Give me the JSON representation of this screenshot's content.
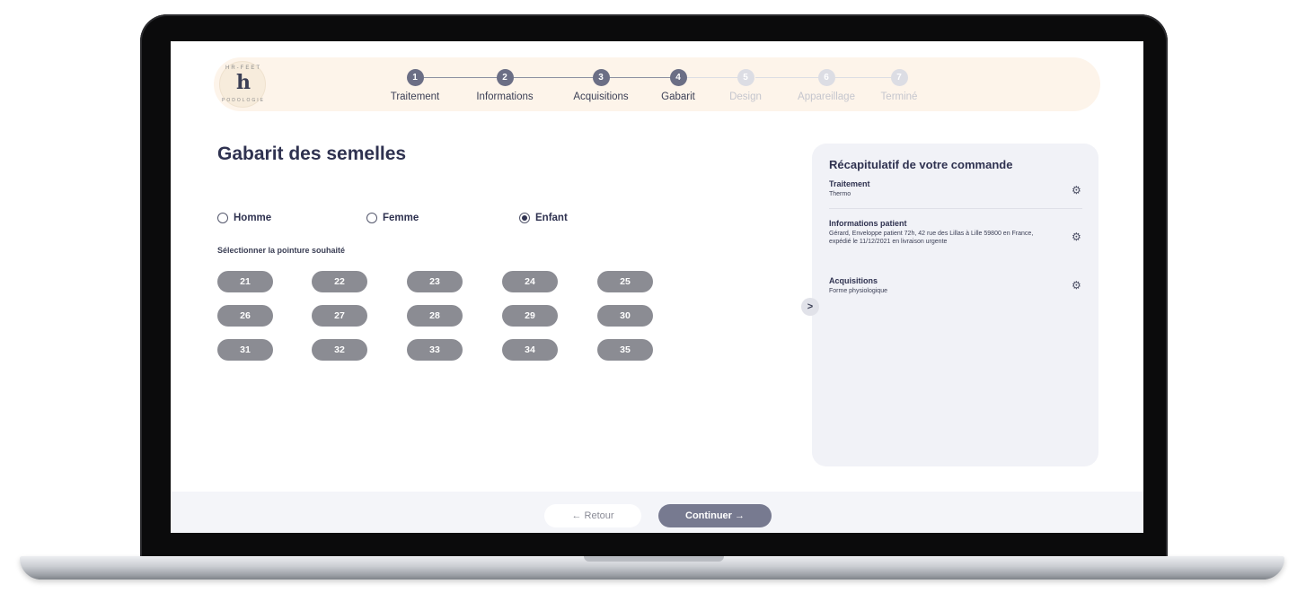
{
  "logo": {
    "letter": "h",
    "top_text": "HR-FEET",
    "bottom_text": "PODOLOGIE"
  },
  "stepper": {
    "steps": [
      {
        "num": "1",
        "label": "Traitement",
        "active": true
      },
      {
        "num": "2",
        "label": "Informations",
        "active": true
      },
      {
        "num": "3",
        "label": "Acquisitions",
        "active": true
      },
      {
        "num": "4",
        "label": "Gabarit",
        "active": true
      },
      {
        "num": "5",
        "label": "Design",
        "active": false
      },
      {
        "num": "6",
        "label": "Appareillage",
        "active": false
      },
      {
        "num": "7",
        "label": "Terminé",
        "active": false
      }
    ]
  },
  "main": {
    "title": "Gabarit des semelles",
    "genders": [
      {
        "label": "Homme",
        "checked": false
      },
      {
        "label": "Femme",
        "checked": false
      },
      {
        "label": "Enfant",
        "checked": true
      }
    ],
    "subtitle": "Sélectionner la pointure souhaité",
    "sizes": [
      "21",
      "22",
      "23",
      "24",
      "25",
      "26",
      "27",
      "28",
      "29",
      "30",
      "31",
      "32",
      "33",
      "34",
      "35"
    ]
  },
  "summary": {
    "title": "Récapitulatif de votre commande",
    "items": [
      {
        "label": "Traitement",
        "value": "Thermo"
      },
      {
        "label": "Informations patient",
        "value": "Gérard, Enveloppe patient 72h, 42 rue des Lillas à Lille 59800 en France, expédié le 11/12/2021 en livraison urgente"
      },
      {
        "label": "Acquisitions",
        "value": "Forme physiologique"
      }
    ],
    "toggle": ">"
  },
  "footer": {
    "back_label": "← Retour",
    "next_label": "Continuer →"
  },
  "icons": {
    "gear": "gear-icon",
    "chevron": "chevron-right-icon"
  }
}
